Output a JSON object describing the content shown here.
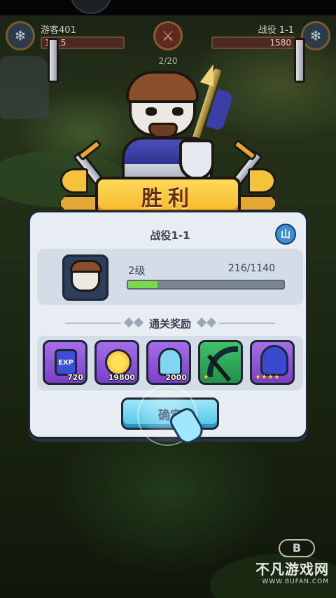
{
  "player": {
    "name": "游客401",
    "power": "1315"
  },
  "enemy": {
    "name": "战役 1-1",
    "power": "1580"
  },
  "wave": "2/20",
  "banner": {
    "text": "胜利"
  },
  "dialog": {
    "stage_title": "战役1-1",
    "map_button_label": "山",
    "hero": {
      "level": "2级",
      "exp_text": "216/1140",
      "exp_current": 216,
      "exp_max": 1140
    },
    "rewards_title": "通关奖励",
    "rewards": [
      {
        "icon": "exp-potion-icon",
        "label": "EXP",
        "amount": "720",
        "rarity": "purple"
      },
      {
        "icon": "gold-coin-icon",
        "amount": "19800",
        "rarity": "purple"
      },
      {
        "icon": "soul-ghost-icon",
        "amount": "2000",
        "rarity": "purple"
      },
      {
        "icon": "scythe-weapon-icon",
        "stars": "★",
        "rarity": "green"
      },
      {
        "icon": "wizard-hero-icon",
        "stars": "★★★★",
        "rarity": "purple"
      }
    ],
    "confirm_label": "确定"
  },
  "watermark": {
    "logo": "B",
    "name": "不凡游戏网",
    "url": "WWW.BUFAN.COM"
  },
  "colors": {
    "banner_gold": "#f6b82a",
    "exp_fill": "#79d94a",
    "confirm_blue": "#4fc3e8",
    "reward_purple": "#7b3fc8",
    "reward_green": "#239048"
  }
}
